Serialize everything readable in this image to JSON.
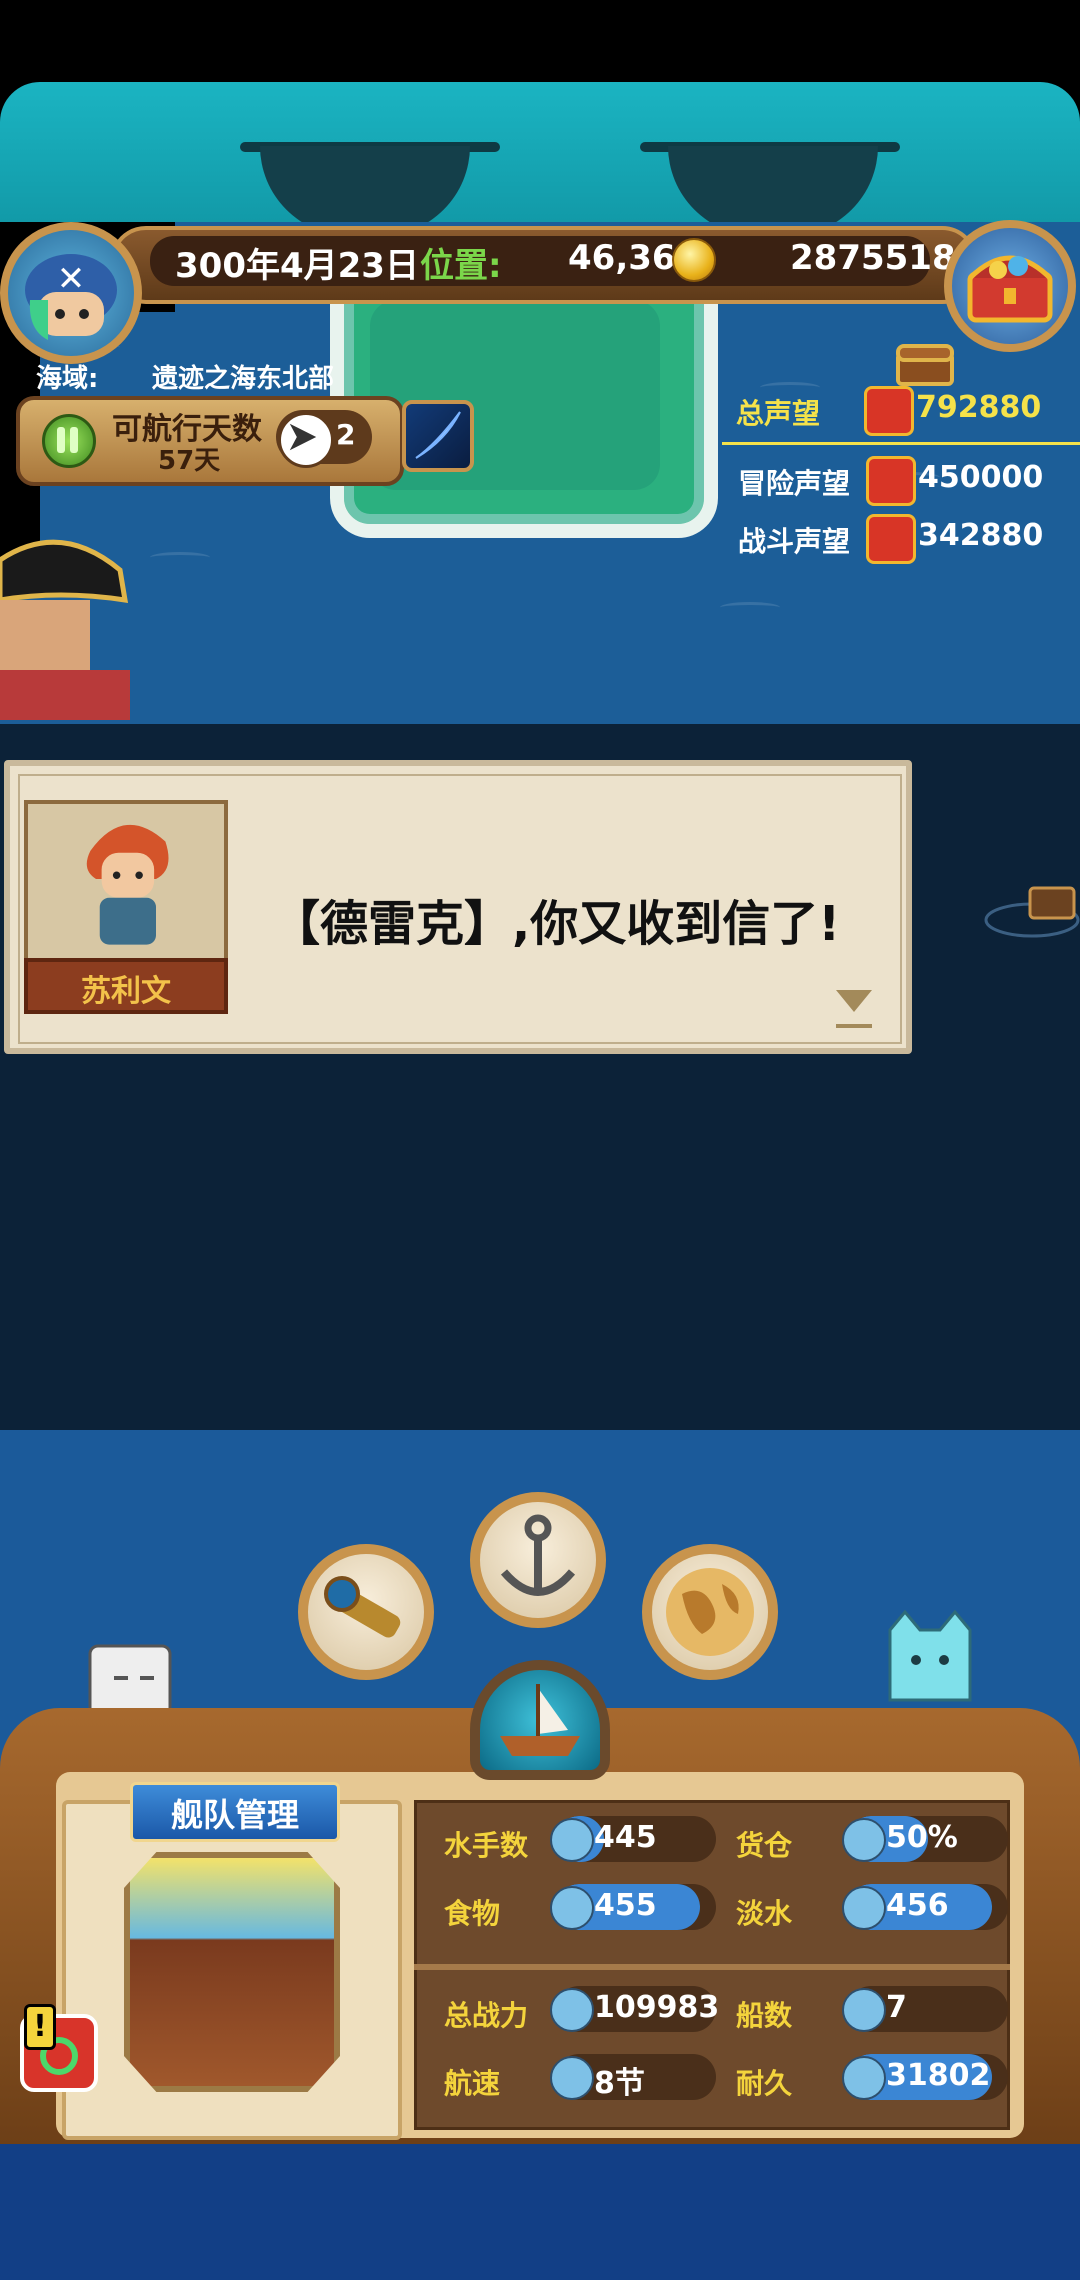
{
  "hud": {
    "date": "300年4月23日",
    "position_label": "位置:",
    "position_value": "46,36",
    "gold": "2875518"
  },
  "sea_area": {
    "label": "海域:",
    "value": "遗迹之海东北部"
  },
  "sailing": {
    "days_label": "可航行天数",
    "days_value": "57天",
    "boost_count": "2"
  },
  "reputation": {
    "total_label": "总声望",
    "total_value": "792880",
    "adventure_label": "冒险声望",
    "adventure_value": "450000",
    "battle_label": "战斗声望",
    "battle_value": "342880"
  },
  "dialog": {
    "speaker": "苏利文",
    "text": "【德雷克】,你又收到信了!"
  },
  "fleet": {
    "title": "舰队管理",
    "alert_mark": "!",
    "stats": [
      {
        "label": "水手数",
        "value": "445",
        "icon": "sailor-icon",
        "fill": 0.3
      },
      {
        "label": "货仓",
        "value": "50%",
        "icon": "crate-icon",
        "fill": 0.5
      },
      {
        "label": "食物",
        "value": "455",
        "icon": "meat-icon",
        "fill": 0.9
      },
      {
        "label": "淡水",
        "value": "456",
        "icon": "water-jug-icon",
        "fill": 0.9
      },
      {
        "label": "总战力",
        "value": "109983",
        "icon": "skull-swords-icon",
        "fill": 0.0
      },
      {
        "label": "船数",
        "value": "7",
        "icon": "ship-icon",
        "fill": 0.0
      },
      {
        "label": "航速",
        "value": "8节",
        "icon": "sail-icon",
        "fill": 0.0
      },
      {
        "label": "耐久",
        "value": "31802",
        "icon": "repair-icon",
        "fill": 0.9
      }
    ]
  },
  "colors": {
    "accent_yellow": "#f5e24a",
    "position_green": "#7bd64a",
    "bar_blue": "#3b86d4",
    "panel_brown": "#6d3f17"
  }
}
